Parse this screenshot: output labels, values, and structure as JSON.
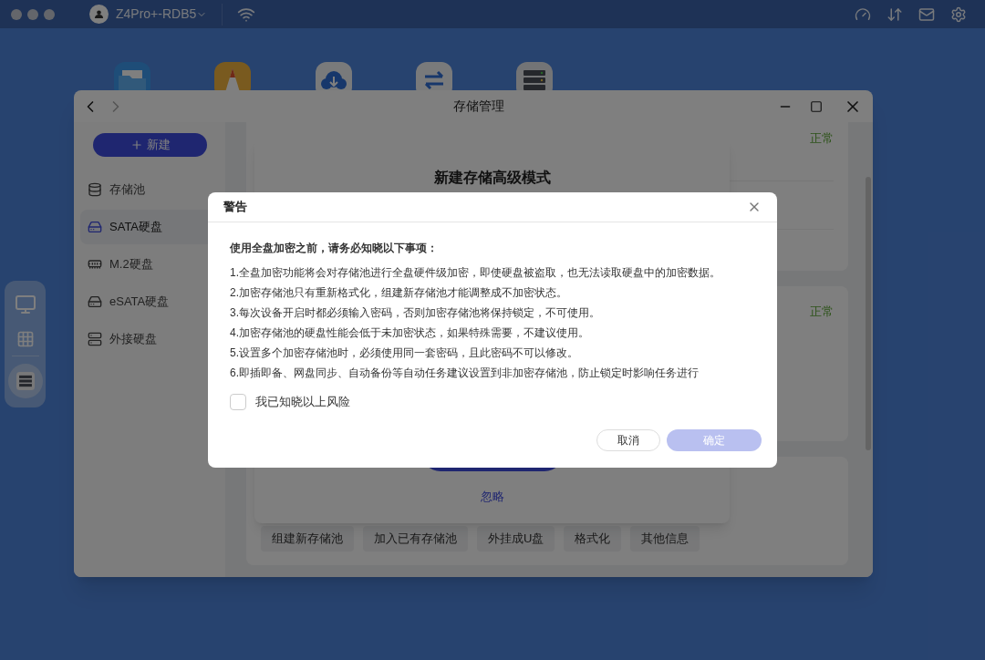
{
  "top_bar": {
    "device_name": "Z4Pro+-RDB5"
  },
  "window": {
    "title": "存储管理",
    "new_button": "新建",
    "sidebar": [
      {
        "label": "存储池",
        "kind": "pool",
        "selected": false
      },
      {
        "label": "SATA硬盘",
        "kind": "sata",
        "selected": true
      },
      {
        "label": "M.2硬盘",
        "kind": "m2",
        "selected": false
      },
      {
        "label": "eSATA硬盘",
        "kind": "sata",
        "selected": false
      },
      {
        "label": "外接硬盘",
        "kind": "external",
        "selected": false
      }
    ],
    "statuses": [
      "正常",
      "正常"
    ],
    "actions": [
      "组建新存储池",
      "加入已有存储池",
      "外挂成U盘",
      "格式化",
      "其他信息"
    ],
    "inner_modal": {
      "title": "新建存储高级模式",
      "link": "忽略"
    }
  },
  "dialog": {
    "title": "警告",
    "heading": "使用全盘加密之前，请务必知晓以下事项：",
    "items": [
      "1.全盘加密功能将会对存储池进行全盘硬件级加密，即使硬盘被盗取，也无法读取硬盘中的加密数据。",
      "2.加密存储池只有重新格式化，组建新存储池才能调整成不加密状态。",
      "3.每次设备开启时都必须输入密码，否则加密存储池将保持锁定，不可使用。",
      "4.加密存储池的硬盘性能会低于未加密状态，如果特殊需要，不建议使用。",
      "5.设置多个加密存储池时，必须使用同一套密码，且此密码不可以修改。",
      "6.即插即备、网盘同步、自动备份等自动任务建议设置到非加密存储池，防止锁定时影响任务进行"
    ],
    "checkbox": {
      "label": "我已知晓以上风险",
      "checked": false
    },
    "cancel_button": "取消",
    "confirm_button": {
      "label": "确定",
      "disabled": true
    }
  }
}
